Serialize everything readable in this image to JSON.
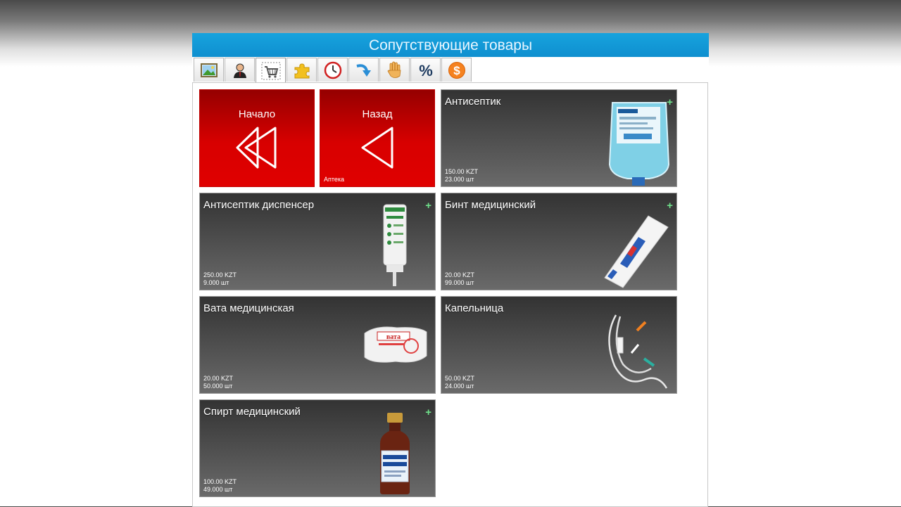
{
  "window": {
    "title": "Сопутствующие товары"
  },
  "toolbar": {
    "buttons": [
      {
        "name": "image-icon",
        "active": false
      },
      {
        "name": "user-icon",
        "active": false
      },
      {
        "name": "cart-icon",
        "active": true
      },
      {
        "name": "puzzle-icon",
        "active": false
      },
      {
        "name": "clock-icon",
        "active": false
      },
      {
        "name": "arrow-turn-icon",
        "active": false
      },
      {
        "name": "hand-icon",
        "active": false
      },
      {
        "name": "percent-icon",
        "active": false
      },
      {
        "name": "dollar-icon",
        "active": false
      }
    ]
  },
  "nav": {
    "home": {
      "label": "Начало"
    },
    "back": {
      "label": "Назад",
      "sub": "Аптека"
    }
  },
  "products": [
    {
      "name": "Антисептик",
      "price": "150.00 KZT",
      "qty": "23.000 шт",
      "plus": "+"
    },
    {
      "name": "Антисептик диспенсер",
      "price": "250.00 KZT",
      "qty": "9.000 шт",
      "plus": "+"
    },
    {
      "name": "Бинт медицинский",
      "price": "20.00 KZT",
      "qty": "99.000 шт",
      "plus": "+"
    },
    {
      "name": "Вата медицинская",
      "price": "20.00 KZT",
      "qty": "50.000 шт",
      "plus": ""
    },
    {
      "name": "Капельница",
      "price": "50.00 KZT",
      "qty": "24.000 шт",
      "plus": ""
    },
    {
      "name": "Спирт медицинский",
      "price": "100.00 KZT",
      "qty": "49.000 шт",
      "plus": "+"
    }
  ],
  "colors": {
    "title_bar": "#0f8fcf",
    "nav_tile": "#d80000",
    "product_tile": "#4a4a4a",
    "plus": "#6fe08a"
  }
}
